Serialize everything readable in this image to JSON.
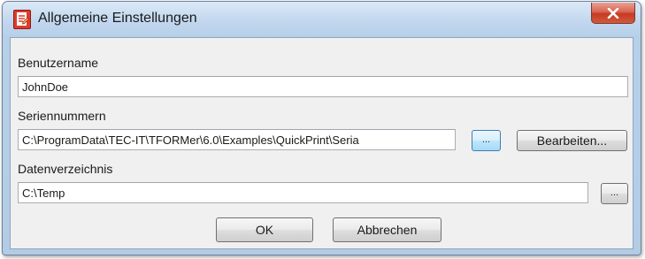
{
  "window": {
    "title": "Allgemeine Einstellungen",
    "icon": "document-icon",
    "close_glyph": "✕"
  },
  "fields": {
    "username": {
      "label": "Benutzername",
      "value": "JohnDoe"
    },
    "serial": {
      "label": "Seriennummern",
      "value": "C:\\ProgramData\\TEC-IT\\TFORMer\\6.0\\Examples\\QuickPrint\\Seria",
      "browse_label": "...",
      "edit_label": "Bearbeiten..."
    },
    "datadir": {
      "label": "Datenverzeichnis",
      "value": "C:\\Temp",
      "browse_label": "..."
    }
  },
  "buttons": {
    "ok": "OK",
    "cancel": "Abbrechen"
  },
  "colors": {
    "accent": "#c63a22",
    "hot_button": "#bee6fd",
    "client_bg": "#f0f0f0"
  }
}
